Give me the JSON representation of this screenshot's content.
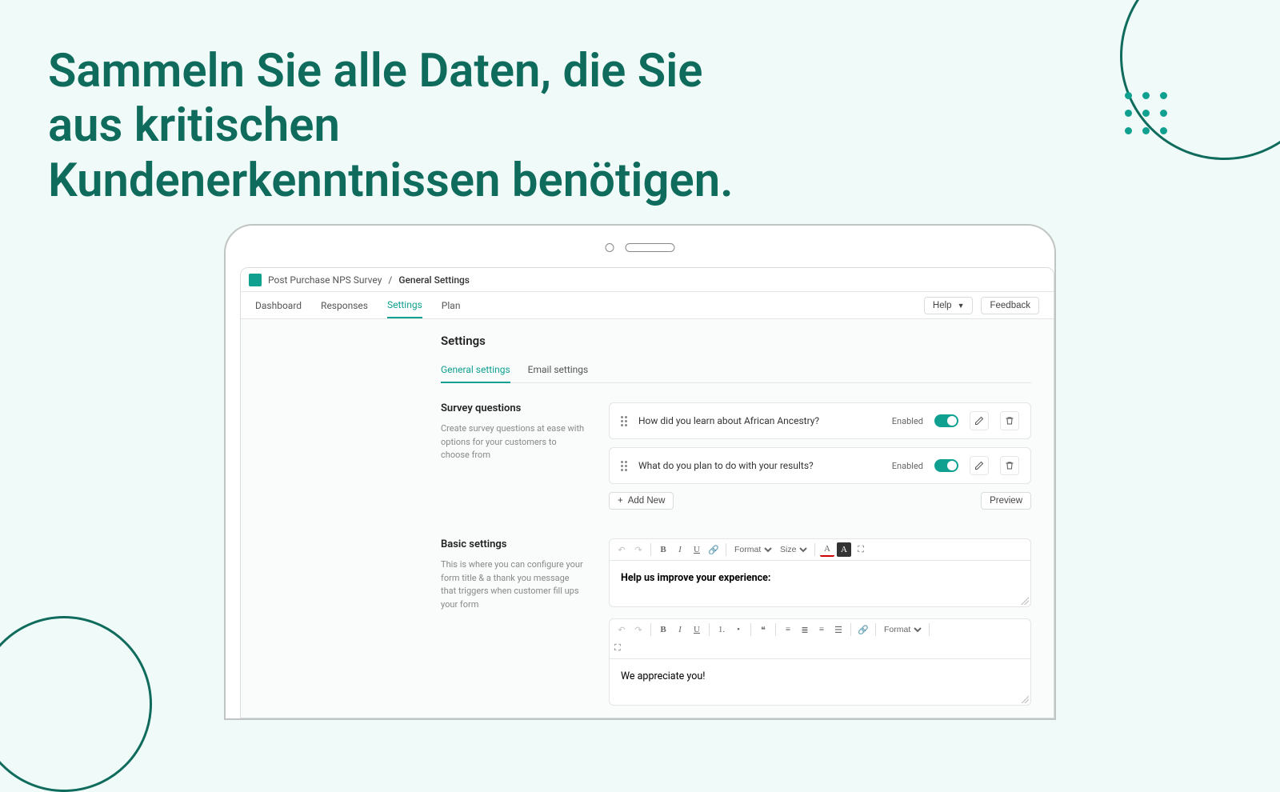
{
  "headline": "Sammeln Sie alle Daten, die Sie aus kritischen Kundenerkenntnissen benötigen.",
  "breadcrumb": {
    "app": "Post Purchase NPS Survey",
    "sep": "/",
    "current": "General Settings"
  },
  "nav": {
    "tabs": [
      "Dashboard",
      "Responses",
      "Settings",
      "Plan"
    ],
    "active": "Settings",
    "help": "Help",
    "feedback": "Feedback"
  },
  "page": {
    "title": "Settings",
    "subtabs": [
      "General settings",
      "Email settings"
    ],
    "subtab_active": "General settings"
  },
  "survey_questions": {
    "heading": "Survey questions",
    "desc": "Create survey questions at ease with options for your customers to choose from",
    "items": [
      {
        "text": "How did you learn about African Ancestry?",
        "status": "Enabled"
      },
      {
        "text": "What do you plan to do with your results?",
        "status": "Enabled"
      }
    ],
    "add_new": "Add New",
    "preview": "Preview"
  },
  "basic_settings": {
    "heading": "Basic settings",
    "desc": "This is where you can configure your form title & a thank you message that triggers when customer fill ups your form",
    "title_editor_text": "Help us improve your experience:",
    "thanks_editor_text": "We appreciate you!"
  },
  "rte": {
    "format": "Format",
    "size": "Size"
  }
}
